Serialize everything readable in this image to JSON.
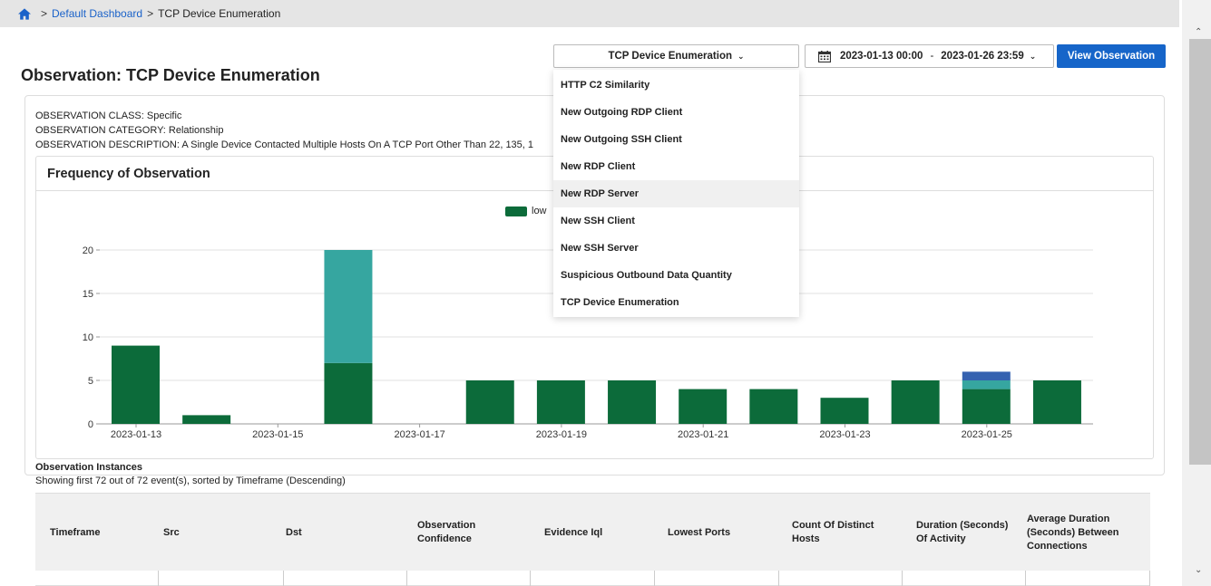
{
  "breadcrumb": {
    "items": [
      "Default Dashboard",
      "TCP Device Enumeration"
    ],
    "separator": ">"
  },
  "page_title": "Observation: TCP Device Enumeration",
  "toolbar": {
    "observation_select": "TCP Device Enumeration",
    "date_start": "2023-01-13 00:00",
    "date_end": "2023-01-26 23:59",
    "date_separator": "-",
    "view_button": "View Observation"
  },
  "dropdown": {
    "options": [
      "HTTP C2 Similarity",
      "New Outgoing RDP Client",
      "New Outgoing SSH Client",
      "New RDP Client",
      "New RDP Server",
      "New SSH Client",
      "New SSH Server",
      "Suspicious Outbound Data Quantity",
      "TCP Device Enumeration"
    ],
    "hovered": "New RDP Server"
  },
  "observation": {
    "class_line": "OBSERVATION CLASS: Specific",
    "category_line": "OBSERVATION CATEGORY: Relationship",
    "description_line": "OBSERVATION DESCRIPTION: A Single Device Contacted Multiple Hosts On A TCP Port Other Than 22, 135, 1"
  },
  "chart_title": "Frequency of Observation",
  "chart_data": {
    "type": "bar",
    "title": "Frequency of Observation",
    "stacked": true,
    "legend": "top-center",
    "xlabel": "",
    "ylabel": "",
    "ylim": [
      0,
      22
    ],
    "yticks": [
      0,
      5,
      10,
      15,
      20
    ],
    "grid": true,
    "categories": [
      "2023-01-13",
      "2023-01-14",
      "2023-01-15",
      "2023-01-16",
      "2023-01-17",
      "2023-01-18",
      "2023-01-19",
      "2023-01-20",
      "2023-01-21",
      "2023-01-22",
      "2023-01-23",
      "2023-01-24",
      "2023-01-25",
      "2023-01-26"
    ],
    "xtick_labels": [
      "2023-01-13",
      "2023-01-15",
      "2023-01-17",
      "2023-01-19",
      "2023-01-21",
      "2023-01-23",
      "2023-01-25"
    ],
    "series": [
      {
        "name": "low",
        "color": "#0c6b3a",
        "values": [
          9,
          1,
          0,
          7,
          0,
          5,
          5,
          5,
          4,
          4,
          3,
          5,
          4,
          5
        ]
      },
      {
        "color": "#36a6a0",
        "values": [
          0,
          0,
          0,
          13,
          0,
          0,
          0,
          0,
          0,
          0,
          0,
          0,
          1,
          0
        ]
      },
      {
        "color": "#3562b0",
        "values": [
          0,
          0,
          0,
          0,
          0,
          0,
          0,
          0,
          0,
          0,
          0,
          0,
          1,
          0
        ]
      }
    ]
  },
  "instances": {
    "title": "Observation Instances",
    "subtitle": "Showing first 72 out of 72 event(s), sorted by Timeframe (Descending)",
    "columns": [
      "Timeframe",
      "Src",
      "Dst",
      "Observation Confidence",
      "Evidence Iql",
      "Lowest Ports",
      "Count Of Distinct Hosts",
      "Duration (Seconds) Of Activity",
      "Average Duration (Seconds) Between Connections"
    ]
  }
}
